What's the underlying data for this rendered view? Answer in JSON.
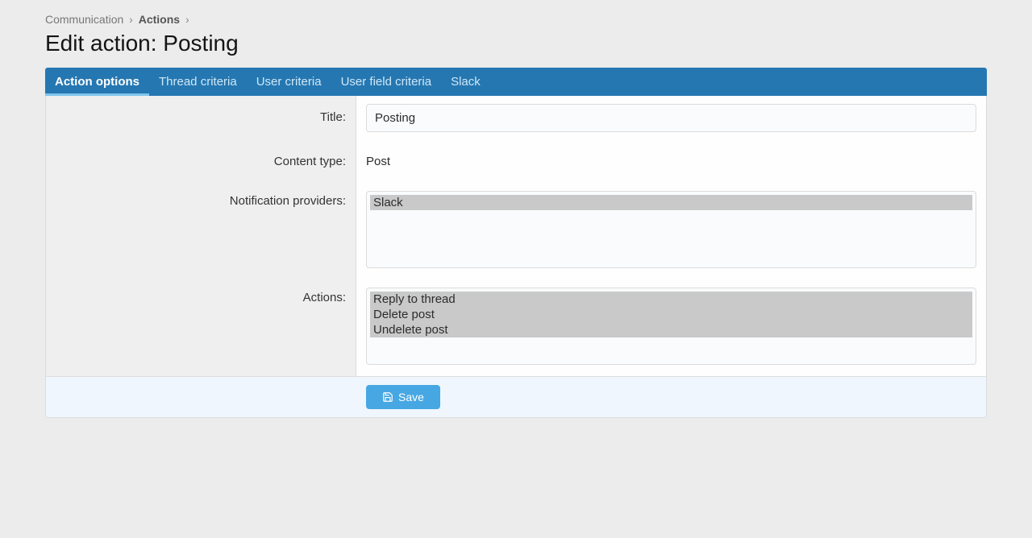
{
  "breadcrumb": {
    "item1": "Communication",
    "item2": "Actions"
  },
  "page_title": "Edit action: Posting",
  "tabs": {
    "action_options": "Action options",
    "thread_criteria": "Thread criteria",
    "user_criteria": "User criteria",
    "user_field_criteria": "User field criteria",
    "slack": "Slack"
  },
  "form": {
    "title_label": "Title:",
    "title_value": "Posting",
    "content_type_label": "Content type:",
    "content_type_value": "Post",
    "notification_providers_label": "Notification providers:",
    "providers": {
      "slack": "Slack"
    },
    "actions_label": "Actions:",
    "actions": {
      "reply_to_thread": "Reply to thread",
      "delete_post": "Delete post",
      "undelete_post": "Undelete post"
    }
  },
  "buttons": {
    "save": "Save"
  }
}
